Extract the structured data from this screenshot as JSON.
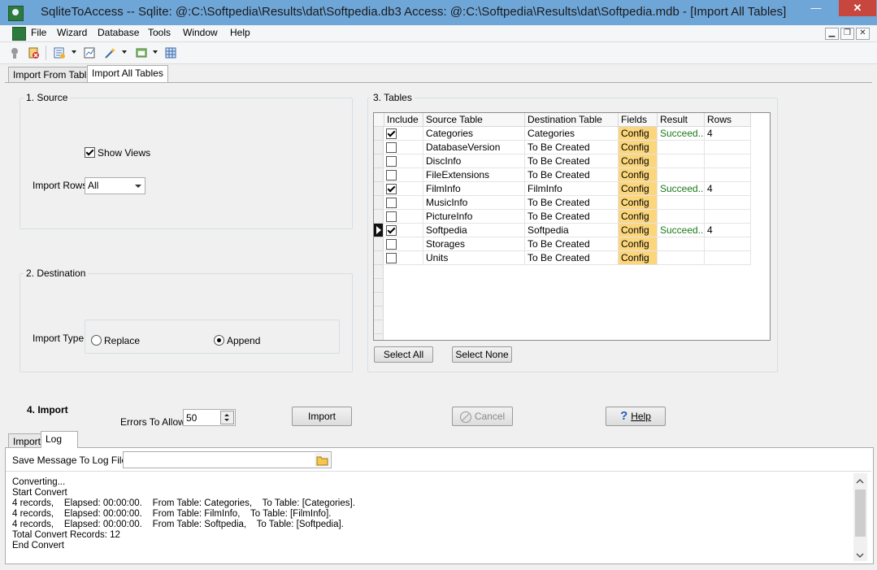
{
  "window": {
    "title": "SqliteToAccess -- Sqlite: @:C:\\Softpedia\\Results\\dat\\Softpedia.db3 Access: @:C:\\Softpedia\\Results\\dat\\Softpedia.mdb - [Import All Tables]",
    "min": "—",
    "max": "☐",
    "close": "✕"
  },
  "menu": [
    "File",
    "Wizard",
    "Database",
    "Tools",
    "Window",
    "Help"
  ],
  "mdi_buttons": [
    "▁",
    "❐",
    "✕"
  ],
  "tabs_top": [
    "Import From Table",
    "Import All Tables"
  ],
  "source": {
    "legend": "1. Source",
    "show_views": "Show Views",
    "import_rows_label": "Import Rows",
    "import_rows_value": "All"
  },
  "destination": {
    "legend": "2. Destination",
    "import_type_label": "Import Type",
    "replace": "Replace",
    "append": "Append"
  },
  "tables": {
    "legend": "3. Tables",
    "columns": [
      "Include",
      "Source Table",
      "Destination Table",
      "Fields",
      "Result",
      "Rows"
    ],
    "rows": [
      {
        "include": true,
        "source": "Categories",
        "dest": "Categories",
        "fields": "Config",
        "result": "Succeed...",
        "rows": "4"
      },
      {
        "include": false,
        "source": "DatabaseVersion",
        "dest": "To Be Created",
        "fields": "Config",
        "result": "",
        "rows": ""
      },
      {
        "include": false,
        "source": "DiscInfo",
        "dest": "To Be Created",
        "fields": "Config",
        "result": "",
        "rows": ""
      },
      {
        "include": false,
        "source": "FileExtensions",
        "dest": "To Be Created",
        "fields": "Config",
        "result": "",
        "rows": ""
      },
      {
        "include": true,
        "source": "FilmInfo",
        "dest": "FilmInfo",
        "fields": "Config",
        "result": "Succeed...",
        "rows": "4"
      },
      {
        "include": false,
        "source": "MusicInfo",
        "dest": "To Be Created",
        "fields": "Config",
        "result": "",
        "rows": ""
      },
      {
        "include": false,
        "source": "PictureInfo",
        "dest": "To Be Created",
        "fields": "Config",
        "result": "",
        "rows": ""
      },
      {
        "include": true,
        "source": "Softpedia",
        "dest": "Softpedia",
        "fields": "Config",
        "result": "Succeed...",
        "rows": "4"
      },
      {
        "include": false,
        "source": "Storages",
        "dest": "To Be Created",
        "fields": "Config",
        "result": "",
        "rows": ""
      },
      {
        "include": false,
        "source": "Units",
        "dest": "To Be Created",
        "fields": "Config",
        "result": "",
        "rows": ""
      }
    ],
    "select_all": "Select All",
    "select_none": "Select None"
  },
  "import": {
    "heading": "4. Import",
    "errors_label": "Errors To Allow",
    "errors_value": "50",
    "import_btn": "Import",
    "cancel_btn": "Cancel",
    "help_btn": "Help"
  },
  "tabs_bottom": [
    "Import",
    "Log"
  ],
  "log": {
    "save_label": "Save Message To Log File",
    "save_value": "",
    "lines": [
      "Converting...",
      "Start Convert",
      "4 records,    Elapsed: 00:00:00.    From Table: Categories,    To Table: [Categories].",
      "4 records,    Elapsed: 00:00:00.    From Table: FilmInfo,    To Table: [FilmInfo].",
      "4 records,    Elapsed: 00:00:00.    From Table: Softpedia,    To Table: [Softpedia].",
      "Total Convert Records: 12",
      "End Convert"
    ]
  },
  "colors": {
    "titlebar": "#6fa6d8",
    "config_bg": "#fbd67c",
    "succeed": "#1a7a1a",
    "close_btn": "#c7463d"
  }
}
